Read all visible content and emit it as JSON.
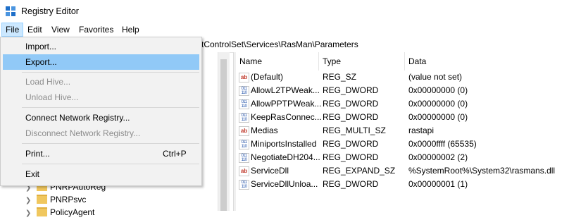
{
  "window": {
    "title": "Registry Editor"
  },
  "menubar": {
    "items": [
      "File",
      "Edit",
      "View",
      "Favorites",
      "Help"
    ]
  },
  "address": {
    "path": "tControlSet\\Services\\RasMan\\Parameters"
  },
  "file_menu": {
    "import": "Import...",
    "export": "Export...",
    "load_hive": "Load Hive...",
    "unload_hive": "Unload Hive...",
    "connect": "Connect Network Registry...",
    "disconnect": "Disconnect Network Registry...",
    "print": "Print...",
    "print_shortcut": "Ctrl+P",
    "exit": "Exit"
  },
  "tree": {
    "items": [
      "PNRPAutoReg",
      "PNRPsvc",
      "PolicyAgent"
    ]
  },
  "values": {
    "columns": [
      "Name",
      "Type",
      "Data"
    ],
    "rows": [
      {
        "icon": "string-value-icon",
        "name": "(Default)",
        "type": "REG_SZ",
        "data": "(value not set)"
      },
      {
        "icon": "binary-value-icon",
        "name": "AllowL2TPWeak...",
        "type": "REG_DWORD",
        "data": "0x00000000 (0)"
      },
      {
        "icon": "binary-value-icon",
        "name": "AllowPPTPWeak...",
        "type": "REG_DWORD",
        "data": "0x00000000 (0)"
      },
      {
        "icon": "binary-value-icon",
        "name": "KeepRasConnec...",
        "type": "REG_DWORD",
        "data": "0x00000000 (0)"
      },
      {
        "icon": "string-value-icon",
        "name": "Medias",
        "type": "REG_MULTI_SZ",
        "data": "rastapi"
      },
      {
        "icon": "binary-value-icon",
        "name": "MiniportsInstalled",
        "type": "REG_DWORD",
        "data": "0x0000ffff (65535)"
      },
      {
        "icon": "binary-value-icon",
        "name": "NegotiateDH204...",
        "type": "REG_DWORD",
        "data": "0x00000002 (2)"
      },
      {
        "icon": "string-value-icon",
        "name": "ServiceDll",
        "type": "REG_EXPAND_SZ",
        "data": "%SystemRoot%\\System32\\rasmans.dll"
      },
      {
        "icon": "binary-value-icon",
        "name": "ServiceDllUnloa...",
        "type": "REG_DWORD",
        "data": "0x00000001 (1)"
      }
    ]
  },
  "colors": {
    "highlight": "#91c9f7",
    "menu_active": "#cce8ff",
    "disabled": "#8d8d8d"
  }
}
